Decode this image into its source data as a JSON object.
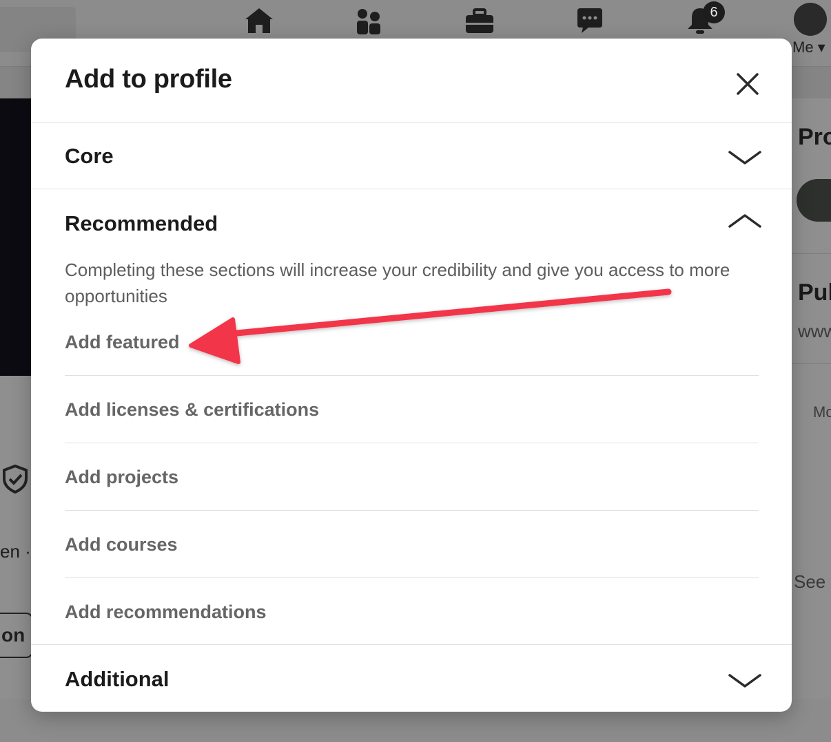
{
  "background": {
    "notification_count": "6",
    "me_label": "Me",
    "right_texts": [
      "Pro",
      "Pul",
      "www",
      "Mo",
      "See"
    ],
    "left_texts": [
      "en ·",
      "on"
    ]
  },
  "modal": {
    "title": "Add to profile",
    "sections": [
      {
        "title": "Core",
        "state": "collapsed"
      },
      {
        "title": "Recommended",
        "state": "expanded"
      },
      {
        "title": "Additional",
        "state": "collapsed"
      }
    ],
    "recommended": {
      "description": "Completing these sections will increase your credibility and give you access to more opportunities",
      "items": [
        {
          "label": "Add featured"
        },
        {
          "label": "Add licenses & certifications"
        },
        {
          "label": "Add projects"
        },
        {
          "label": "Add courses"
        },
        {
          "label": "Add recommendations"
        }
      ]
    }
  },
  "annotation": {
    "type": "arrow",
    "color": "#f2364a",
    "points_to": "Add featured"
  }
}
